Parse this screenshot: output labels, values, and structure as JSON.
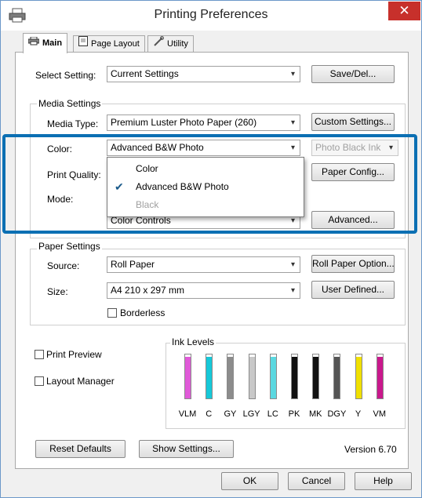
{
  "window": {
    "title": "Printing Preferences",
    "close_label": "✕"
  },
  "tabs": [
    {
      "label": "Main"
    },
    {
      "label": "Page Layout"
    },
    {
      "label": "Utility"
    }
  ],
  "select_setting": {
    "label": "Select Setting:",
    "value": "Current Settings",
    "button": "Save/Del..."
  },
  "media_settings": {
    "group_title": "Media Settings",
    "media_type_label": "Media Type:",
    "media_type_value": "Premium Luster Photo Paper (260)",
    "custom_settings_button": "Custom Settings...",
    "color_label": "Color:",
    "color_value": "Advanced B&W Photo",
    "ink_value": "Photo Black Ink",
    "print_quality_label": "Print Quality:",
    "paper_config_button": "Paper Config...",
    "mode_label": "Mode:",
    "mode_value": "Color Controls",
    "advanced_button": "Advanced..."
  },
  "color_dropdown": {
    "options": [
      {
        "label": "Color",
        "checked": false,
        "disabled": false
      },
      {
        "label": "Advanced B&W Photo",
        "checked": true,
        "disabled": false
      },
      {
        "label": "Black",
        "checked": false,
        "disabled": true
      }
    ]
  },
  "paper_settings": {
    "group_title": "Paper Settings",
    "source_label": "Source:",
    "source_value": "Roll Paper",
    "roll_paper_option_button": "Roll Paper Option...",
    "size_label": "Size:",
    "size_value": "A4 210 x 297 mm",
    "user_defined_button": "User Defined...",
    "borderless_label": "Borderless"
  },
  "print_preview_label": "Print Preview",
  "layout_manager_label": "Layout Manager",
  "ink_levels": {
    "title": "Ink Levels",
    "inks": [
      {
        "name": "VLM",
        "color": "#e05ad8",
        "level": 0.95
      },
      {
        "name": "C",
        "color": "#16c8d8",
        "level": 0.95
      },
      {
        "name": "GY",
        "color": "#8c8c8c",
        "level": 0.95
      },
      {
        "name": "LGY",
        "color": "#c8c8c8",
        "level": 0.95
      },
      {
        "name": "LC",
        "color": "#5ad8e0",
        "level": 0.95
      },
      {
        "name": "PK",
        "color": "#111111",
        "level": 0.95
      },
      {
        "name": "MK",
        "color": "#111111",
        "level": 0.95
      },
      {
        "name": "DGY",
        "color": "#555555",
        "level": 0.95
      },
      {
        "name": "Y",
        "color": "#f0e000",
        "level": 0.95
      },
      {
        "name": "VM",
        "color": "#c9188c",
        "level": 0.95
      }
    ]
  },
  "bottom_panel": {
    "reset_defaults_button": "Reset Defaults",
    "show_settings_button": "Show Settings...",
    "version": "Version 6.70"
  },
  "footer": {
    "ok": "OK",
    "cancel": "Cancel",
    "help": "Help"
  }
}
